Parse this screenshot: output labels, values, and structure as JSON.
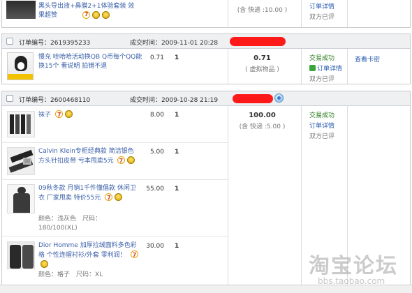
{
  "order0": {
    "title": "黑头导出液+鼻膜2+1体验套装 效果超赞",
    "total": "(含 快递 :10.00 )",
    "detail": "订单详情",
    "review": "双方已评"
  },
  "order1": {
    "id_label": "订单编号：",
    "id": "2619395233",
    "time_label": "成交时间：",
    "time": "2009-11-01 20:28",
    "item_title": "慢充 哇哈哈活动换QB Q币每个QQ能换15个 看说明 拍错不退",
    "price": "0.71",
    "qty": "1",
    "total": "0.71",
    "total_note": "( 虚拟物品 )",
    "status": "交易成功",
    "detail": "订单详情",
    "review": "双方已评",
    "view_card": "查看卡密"
  },
  "order2": {
    "id_label": "订单编号：",
    "id": "2600468110",
    "time_label": "成交时间：",
    "time": "2009-10-28 21:19",
    "total": "100.00",
    "total_note": "(含 快递 :5.00 )",
    "status": "交易成功",
    "detail": "订单详情",
    "review": "双方已评",
    "items": [
      {
        "title": "袜子",
        "price": "8.00",
        "qty": "1"
      },
      {
        "title": "Calvin Klein专柜经典款 简洁银色方头针扣皮带 亏本甩卖5元",
        "price": "5.00",
        "qty": "1"
      },
      {
        "title": "09秋冬款 月销1千件懂倡款 休闲卫衣 厂家甩卖 特价55元",
        "price": "55.00",
        "qty": "1",
        "attr_color": "颜色：浅灰色",
        "attr_size": "尺码：",
        "attr_size2": "180/100(XL)"
      },
      {
        "title": "Dior Homme 加厚拉绒面料多色彩格 个性连帽衬衫/外套 零利润！",
        "price": "30.00",
        "qty": "1",
        "attr": "颜色：格子　尺码：XL"
      }
    ]
  },
  "watermark": {
    "main": "淘宝论坛",
    "sub": "bbs.taobao.com"
  },
  "colors": {
    "link": "#3a5fa8",
    "success": "#2a7a1a",
    "redact": "#ff1a1a",
    "header_bg": "#eef0f2"
  }
}
